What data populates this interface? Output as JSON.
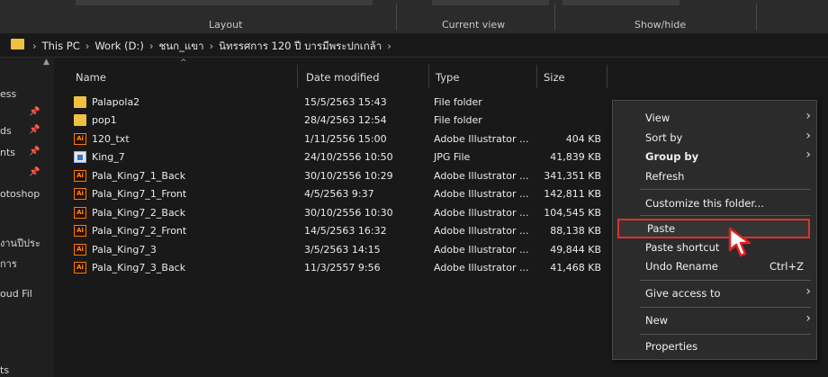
{
  "ribbon": {
    "groups": [
      "Layout",
      "Current view",
      "Show/hide"
    ]
  },
  "address_bar": {
    "crumbs": [
      "This PC",
      "Work (D:)",
      "ชนก_แขา",
      "นิทรรศการ 120 ปี บารมีพระปกเกล้า"
    ]
  },
  "sidebar": {
    "items": [
      "ess",
      "ds",
      "nts",
      "otoshop",
      "งานปีประ",
      "การ",
      "oud Fil",
      "ts"
    ]
  },
  "columns": {
    "name": "Name",
    "date": "Date modified",
    "type": "Type",
    "size": "Size"
  },
  "files": [
    {
      "name": "Palapola2",
      "date": "15/5/2563 15:43",
      "type": "File folder",
      "size": "",
      "icon": "folder-icon"
    },
    {
      "name": "pop1",
      "date": "28/4/2563 12:54",
      "type": "File folder",
      "size": "",
      "icon": "folder-icon"
    },
    {
      "name": "120_txt",
      "date": "1/11/2556 15:00",
      "type": "Adobe Illustrator ...",
      "size": "404 KB",
      "icon": "illustrator-file-icon"
    },
    {
      "name": "King_7",
      "date": "24/10/2556 10:50",
      "type": "JPG File",
      "size": "41,839 KB",
      "icon": "jpg-file-icon"
    },
    {
      "name": "Pala_King7_1_Back",
      "date": "30/10/2556 10:29",
      "type": "Adobe Illustrator ...",
      "size": "341,351 KB",
      "icon": "illustrator-file-icon"
    },
    {
      "name": "Pala_King7_1_Front",
      "date": "4/5/2563 9:37",
      "type": "Adobe Illustrator ...",
      "size": "142,811 KB",
      "icon": "illustrator-file-icon"
    },
    {
      "name": "Pala_King7_2_Back",
      "date": "30/10/2556 10:30",
      "type": "Adobe Illustrator ...",
      "size": "104,545 KB",
      "icon": "illustrator-file-icon"
    },
    {
      "name": "Pala_King7_2_Front",
      "date": "14/5/2563 16:32",
      "type": "Adobe Illustrator ...",
      "size": "88,138 KB",
      "icon": "illustrator-file-icon"
    },
    {
      "name": "Pala_King7_3",
      "date": "3/5/2563 14:15",
      "type": "Adobe Illustrator ...",
      "size": "49,844 KB",
      "icon": "illustrator-file-icon"
    },
    {
      "name": "Pala_King7_3_Back",
      "date": "11/3/2557 9:56",
      "type": "Adobe Illustrator ...",
      "size": "41,468 KB",
      "icon": "illustrator-file-icon"
    }
  ],
  "context_menu": {
    "view": "View",
    "sort_by": "Sort by",
    "group_by": "Group by",
    "refresh": "Refresh",
    "customize": "Customize this folder...",
    "paste": "Paste",
    "paste_shortcut": "Paste shortcut",
    "undo_rename": "Undo Rename",
    "undo_shortcut_key": "Ctrl+Z",
    "give_access": "Give access to",
    "new": "New",
    "properties": "Properties"
  },
  "colors": {
    "highlight_border": "#e03030",
    "folder": "#f0c040",
    "illustrator": "#ff7a00"
  }
}
